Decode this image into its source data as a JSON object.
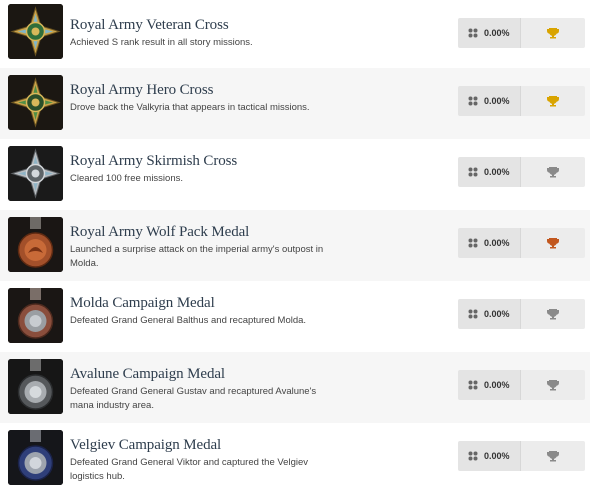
{
  "trophies": [
    {
      "title": "Royal Army Veteran Cross",
      "description": "Achieved S rank result in all story missions.",
      "percent": "0.00%",
      "grade": "gold",
      "medal": "cross-gold-icon"
    },
    {
      "title": "Royal Army Hero Cross",
      "description": "Drove back the Valkyria that appears in tactical missions.",
      "percent": "0.00%",
      "grade": "gold",
      "medal": "cross-gold-icon"
    },
    {
      "title": "Royal Army Skirmish Cross",
      "description": "Cleared 100 free missions.",
      "percent": "0.00%",
      "grade": "silver",
      "medal": "cross-silver-icon"
    },
    {
      "title": "Royal Army Wolf Pack Medal",
      "description": "Launched a surprise attack on the imperial army's outpost in Molda.",
      "percent": "0.00%",
      "grade": "bronze",
      "medal": "medal-bronze-icon"
    },
    {
      "title": "Molda Campaign Medal",
      "description": "Defeated Grand General Balthus and recaptured Molda.",
      "percent": "0.00%",
      "grade": "silver",
      "medal": "medal-copper-icon"
    },
    {
      "title": "Avalune Campaign Medal",
      "description": "Defeated Grand General Gustav and recaptured Avalune's mana industry area.",
      "percent": "0.00%",
      "grade": "silver",
      "medal": "medal-steel-icon"
    },
    {
      "title": "Velgiev Campaign Medal",
      "description": "Defeated Grand General Viktor and captured the Velgiev logistics hub.",
      "percent": "0.00%",
      "grade": "silver",
      "medal": "medal-blue-icon"
    }
  ],
  "colors": {
    "gold": "#d9a400",
    "silver": "#8a8a8a",
    "bronze": "#c2571e",
    "title": "#2e3d4d"
  }
}
